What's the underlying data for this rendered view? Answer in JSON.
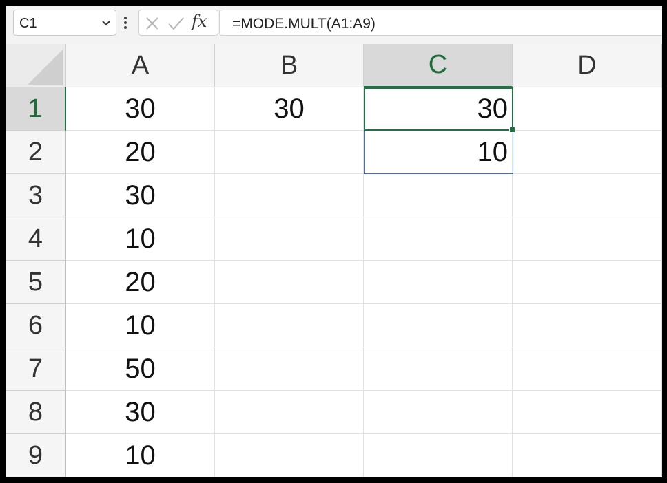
{
  "formula_bar": {
    "name_box": "C1",
    "formula": "=MODE.MULT(A1:A9)",
    "fx_label": "fx",
    "icons": [
      "chevron-down-icon",
      "more-options-icon",
      "cancel-icon",
      "enter-icon",
      "insert-function-icon"
    ]
  },
  "columns": [
    "A",
    "B",
    "C",
    "D"
  ],
  "rows": [
    "1",
    "2",
    "3",
    "4",
    "5",
    "6",
    "7",
    "8",
    "9"
  ],
  "cells": {
    "A1": "30",
    "A2": "20",
    "A3": "30",
    "A4": "10",
    "A5": "20",
    "A6": "10",
    "A7": "50",
    "A8": "30",
    "A9": "10",
    "B1": "30",
    "C1": "30",
    "C2": "10"
  },
  "selection": {
    "active_cell": "C1",
    "spill_range": "C1:C2"
  },
  "colors": {
    "accent_green": "#1f7244",
    "spill_blue": "#3a6fc4"
  }
}
